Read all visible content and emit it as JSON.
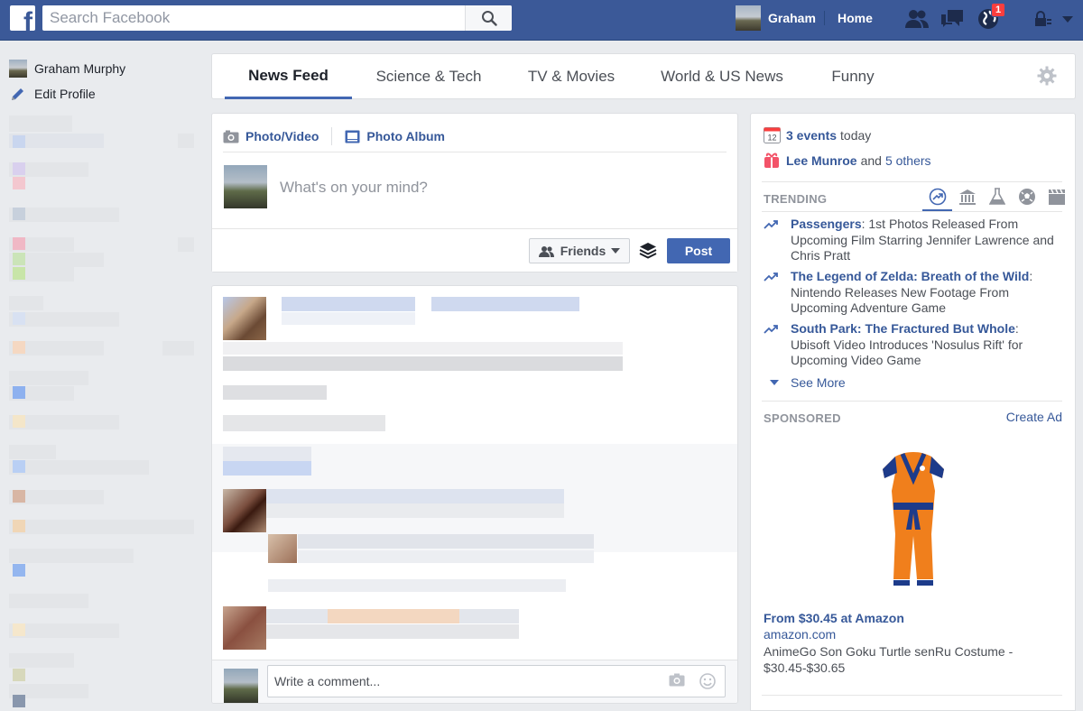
{
  "colors": {
    "brand": "#3b5998",
    "link": "#365899",
    "accent": "#4267b2",
    "badge": "#fa3e3e"
  },
  "topbar": {
    "search_placeholder": "Search Facebook",
    "user_name": "Graham",
    "home_label": "Home",
    "notification_count": "1",
    "icons": [
      "facebook-logo",
      "search-icon",
      "friend-requests-icon",
      "messages-icon",
      "notifications-globe-icon",
      "privacy-lock-icon",
      "account-menu-icon"
    ]
  },
  "left_nav": {
    "items": [
      {
        "label": "Graham Murphy",
        "icon": "profile-avatar"
      },
      {
        "label": "Edit Profile",
        "icon": "pencil-icon"
      }
    ]
  },
  "tabs": {
    "items": [
      {
        "label": "News Feed",
        "active": true
      },
      {
        "label": "Science & Tech",
        "active": false
      },
      {
        "label": "TV & Movies",
        "active": false
      },
      {
        "label": "World & US News",
        "active": false
      },
      {
        "label": "Funny",
        "active": false
      }
    ],
    "settings_icon": "gear-icon"
  },
  "composer": {
    "photo_video": "Photo/Video",
    "photo_album": "Photo Album",
    "placeholder": "What's on your mind?",
    "audience": "Friends",
    "post_label": "Post"
  },
  "story": {
    "comment_placeholder": "Write a comment..."
  },
  "right": {
    "events": {
      "count_text": "3 events",
      "suffix": "today",
      "date_icon_day": "12"
    },
    "birthday": {
      "name": "Lee Munroe",
      "and": "and",
      "others": "5 others"
    },
    "trending": {
      "heading": "TRENDING",
      "items": [
        {
          "title": "Passengers",
          "text": ": 1st Photos Released From Upcoming Film Starring Jennifer Lawrence and Chris Pratt"
        },
        {
          "title": "The Legend of Zelda: Breath of the Wild",
          "text": ": Nintendo Releases New Footage From Upcoming Adventure Game"
        },
        {
          "title": "South Park: The Fractured But Whole",
          "text": ": Ubisoft Video Introduces 'Nosulus Rift' for Upcoming Video Game"
        }
      ],
      "see_more": "See More"
    },
    "sponsored": {
      "heading": "SPONSORED",
      "create_ad": "Create Ad",
      "title": "From $30.45 at Amazon",
      "domain": "amazon.com",
      "description": "AnimeGo Son Goku Turtle senRu Costume - $30.45-$30.65"
    }
  }
}
